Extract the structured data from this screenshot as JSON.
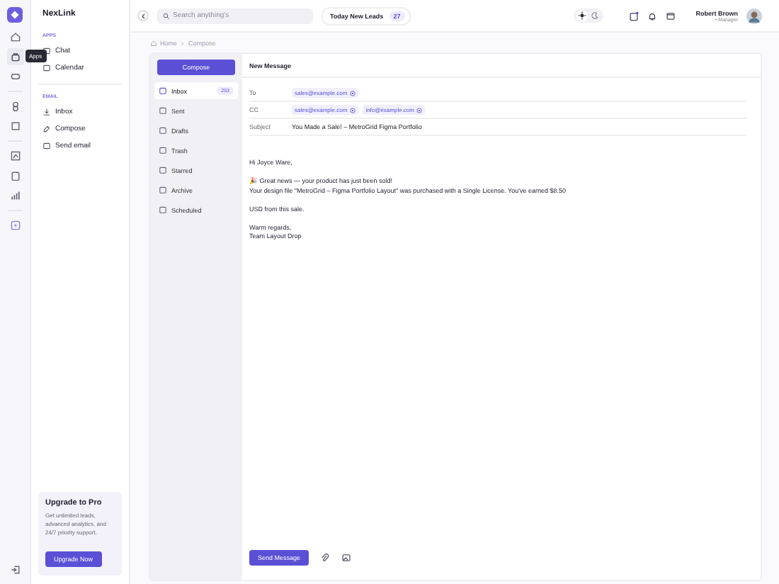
{
  "brand": {
    "name": "NexLink"
  },
  "rail": {
    "tooltip": "Apps"
  },
  "sidebar": {
    "sections": [
      {
        "heading": "APPS",
        "items": [
          {
            "label": "Chat"
          },
          {
            "label": "Calendar"
          }
        ]
      },
      {
        "heading": "EMAIL",
        "items": [
          {
            "label": "Inbox"
          },
          {
            "label": "Compose"
          },
          {
            "label": "Send email"
          }
        ]
      }
    ]
  },
  "upgrade": {
    "title": "Upgrade to Pro",
    "text": "Get unlimited leads, advanced analytics, and 24/7 priority support.",
    "button": "Upgrade Now"
  },
  "theme_toggle": [
    {
      "kind": "sun",
      "selected": true
    },
    {
      "kind": "moon",
      "selected": false
    }
  ],
  "topbar": {
    "search_placeholder": "Search anything's",
    "leads_label": "Today New Leads",
    "leads_count": "27",
    "user_name": "Robert Brown",
    "user_role": "• Manager"
  },
  "breadcrumb": [
    "Home",
    "Compose"
  ],
  "mail_nav": {
    "compose_button": "Compose",
    "folders": [
      {
        "label": "Inbox",
        "badge": "253",
        "selected": true
      },
      {
        "label": "Sent",
        "selected": false
      },
      {
        "label": "Drafts",
        "selected": false
      },
      {
        "label": "Trash",
        "selected": false
      },
      {
        "label": "Starred",
        "selected": false
      },
      {
        "label": "Archive",
        "selected": false
      },
      {
        "label": "Scheduled",
        "selected": false
      }
    ]
  },
  "message": {
    "title": "New Message",
    "to_label": "To",
    "to": [
      "sales@example.com"
    ],
    "cc_label": "CC",
    "cc": [
      "sales@example.com",
      "info@example.com"
    ],
    "subject_label": "Subject",
    "subject": "You Made a Sale! – MetroGrid Figma Portfolio",
    "body": [
      [
        "Hi Joyce Ware,"
      ],
      [
        "🎉 Great news — your product has just been sold!",
        "Your design file \"MetroGrid – Figma Portfolio Layout\" was purchased with a Single License. You've earned $8.50"
      ],
      [
        "USD from this sale."
      ],
      [
        "Warm regards,",
        "Team Layout Drop"
      ]
    ],
    "send_button": "Send Message"
  }
}
